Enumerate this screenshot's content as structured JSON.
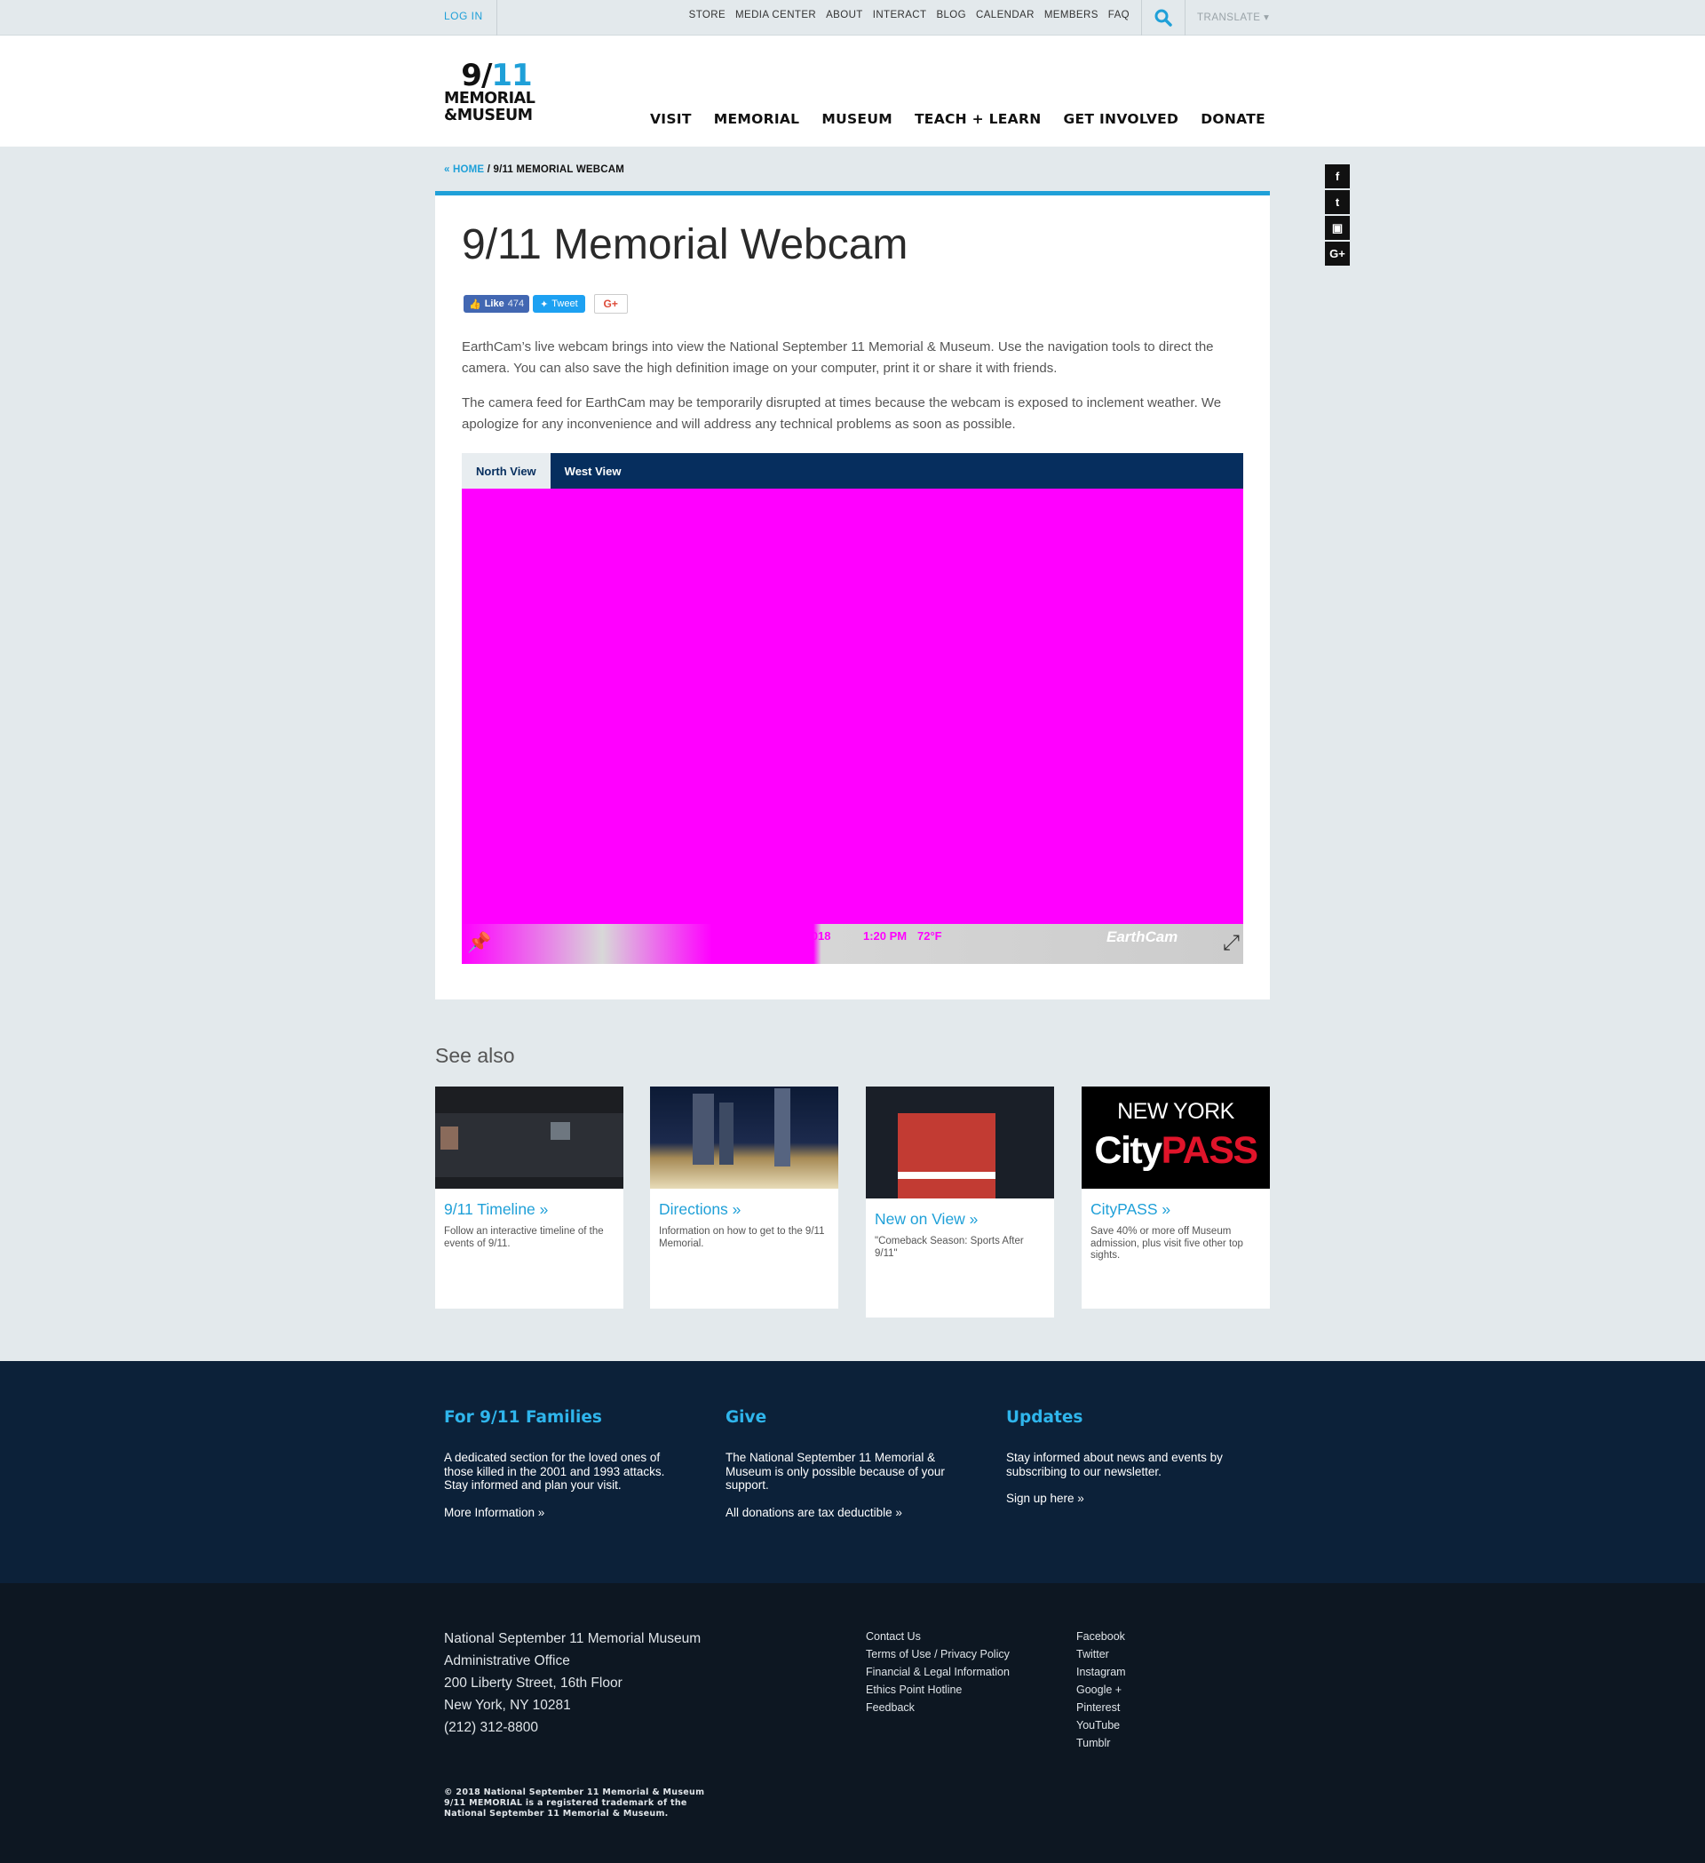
{
  "utility_bar": {
    "login": "LOG IN",
    "links": [
      "STORE",
      "MEDIA CENTER",
      "ABOUT",
      "INTERACT",
      "BLOG",
      "CALENDAR",
      "MEMBERS",
      "FAQ"
    ],
    "translate": "TRANSLATE ▾",
    "search_icon": "search-icon"
  },
  "logo": {
    "line1": "9/",
    "line1_blue": "11",
    "line2": "MEMORIAL",
    "line3": "&MUSEUM"
  },
  "main_nav": [
    "VISIT",
    "MEMORIAL",
    "MUSEUM",
    "TEACH + LEARN",
    "GET INVOLVED",
    "DONATE"
  ],
  "breadcrumb": {
    "home": "« HOME",
    "separator": " / ",
    "current": "9/11 MEMORIAL WEBCAM"
  },
  "social_float": [
    "f",
    "t",
    "▣",
    "G+"
  ],
  "page": {
    "title": "9/11 Memorial Webcam",
    "share": {
      "like_label": "Like",
      "like_count": "474",
      "tweet_label": "Tweet",
      "gplus_label": "G+"
    },
    "intro_1": "EarthCam’s live webcam brings into view the National September 11 Memorial & Museum. Use the navigation tools to direct the camera. You can also save the high definition image on your computer, print it or share it with friends.",
    "intro_2": "The camera feed for EarthCam may be temporarily disrupted at times because the webcam is exposed to inclement weather. We apologize for any inconvenience and will address any technical problems as soon as possible.",
    "tabs": [
      "North View",
      "West View"
    ],
    "webcam": {
      "date": "Aug 13, 2018",
      "time": "1:20 PM",
      "temperature": "72°F",
      "brand": "EarthCam",
      "pin_icon": "pin-icon",
      "expand_icon": "expand-icon"
    }
  },
  "see_also": {
    "title": "See also",
    "tiles": [
      {
        "title": "9/11 Timeline »",
        "desc": "Follow an interactive timeline of the events of 9/11."
      },
      {
        "title": "Directions »",
        "desc": "Information on how to get to the 9/11 Memorial."
      },
      {
        "title": "New on View »",
        "desc": "\"Comeback Season: Sports After 9/11\""
      },
      {
        "title": "CityPASS »",
        "desc": "Save 40% or more off Museum admission, plus visit five other top sights.",
        "thumb_top": "NEW YORK",
        "thumb_city": "City",
        "thumb_pass": "PASS"
      }
    ]
  },
  "updates_band": [
    {
      "title": "For 9/11 Families",
      "body": "A dedicated section for the loved ones of those killed in the 2001 and 1993 attacks. Stay informed and plan your visit.",
      "link": "More Information »"
    },
    {
      "title": "Give",
      "body": "The National September 11 Memorial & Museum is only possible because of your support.",
      "link": "All donations are tax deductible »"
    },
    {
      "title": "Updates",
      "body": "Stay informed about news and events by subscribing to our newsletter.",
      "link": "Sign up here »"
    }
  ],
  "footer": {
    "address": [
      "National September 11 Memorial Museum",
      "Administrative Office",
      "200 Liberty Street, 16th Floor",
      "New York, NY 10281",
      "(212) 312-8800"
    ],
    "links": [
      "Contact Us",
      "Terms of Use / Privacy Policy",
      "Financial & Legal Information",
      "Ethics Point Hotline",
      "Feedback"
    ],
    "social": [
      "Facebook",
      "Twitter",
      "Instagram",
      "Google +",
      "Pinterest",
      "YouTube",
      "Tumblr"
    ],
    "copyright": [
      "© 2018 National September 11 Memorial & Museum",
      "9/11 MEMORIAL is a registered trademark of the",
      "National September 11 Memorial & Museum."
    ]
  },
  "colors": {
    "accent": "#1fa0d8",
    "navy": "#062e5e",
    "band": "#0c2139",
    "footer": "#0d1722",
    "webcam_placeholder": "#ff00ff"
  }
}
